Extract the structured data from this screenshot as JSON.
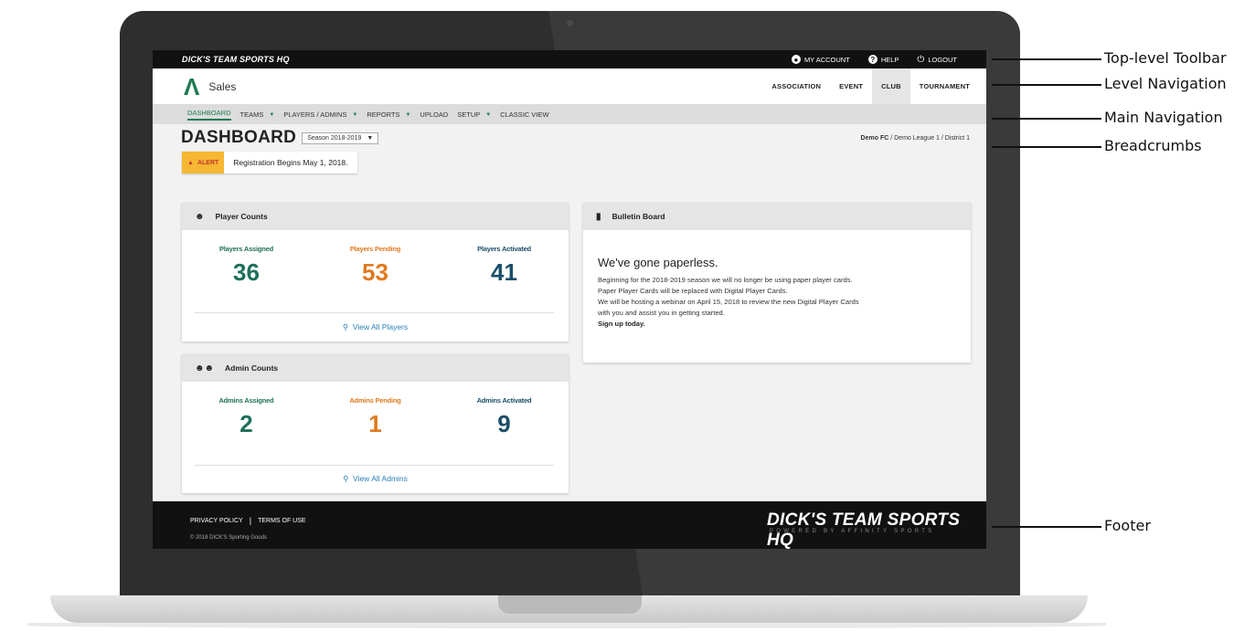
{
  "toolbar": {
    "brand": "DICK'S TEAM SPORTS HQ",
    "my_account": "MY ACCOUNT",
    "help": "HELP",
    "logout": "LOGOUT"
  },
  "level_nav": {
    "app_name": "Sales",
    "levels": [
      "ASSOCIATION",
      "EVENT",
      "CLUB",
      "TOURNAMENT"
    ],
    "active_level": "CLUB"
  },
  "main_nav": {
    "items": [
      "DASHBOARD",
      "TEAMS",
      "PLAYERS / ADMINS",
      "REPORTS",
      "UPLOAD",
      "SETUP",
      "CLASSIC VIEW"
    ]
  },
  "header": {
    "title": "DASHBOARD",
    "season": "Season 2018-2019",
    "breadcrumb_current": "Demo FC",
    "breadcrumb_rest": " / Demo League 1 / District 1"
  },
  "alert": {
    "tag": "ALERT",
    "text": "Registration Begins May 1, 2018."
  },
  "player_counts": {
    "title": "Player Counts",
    "assigned_label": "Players Assigned",
    "assigned": "36",
    "pending_label": "Players Pending",
    "pending": "53",
    "activated_label": "Players Activated",
    "activated": "41",
    "view_all": "View All Players"
  },
  "admin_counts": {
    "title": "Admin Counts",
    "assigned_label": "Admins Assigned",
    "assigned": "2",
    "pending_label": "Admins Pending",
    "pending": "1",
    "activated_label": "Admins Activated",
    "activated": "9",
    "view_all": "View All Admins"
  },
  "bulletin": {
    "title": "Bulletin Board",
    "headline": "We've gone paperless.",
    "line1": "Beginning for the 2018-2019 season we will no longer be using paper player cards.",
    "line2": "Paper Player Cards will be replaced with Digital Player Cards.",
    "line3": "We will be hosting a webinar on April 15, 2018 to review the new Digital Player Cards",
    "line4": "with you and assist you in getting started.",
    "cta": "Sign up today."
  },
  "footer": {
    "privacy": "PRIVACY POLICY",
    "terms": "TERMS OF USE",
    "copyright": "© 2018 DICK'S Sporting Goods",
    "brand": "DICK'S TEAM SPORTS HQ",
    "powered": "POWERED BY AFFINITY SPORTS"
  },
  "annotations": {
    "toolbar": "Top-level Toolbar",
    "level_nav": "Level Navigation",
    "main_nav": "Main Navigation",
    "breadcrumbs": "Breadcrumbs",
    "footer": "Footer"
  },
  "colors": {
    "brand_green": "#1e7a52",
    "assigned": "#1f6f5a",
    "pending": "#e07a1f",
    "activated": "#1b4e68",
    "alert": "#f6b732",
    "link": "#2a7fb8"
  }
}
